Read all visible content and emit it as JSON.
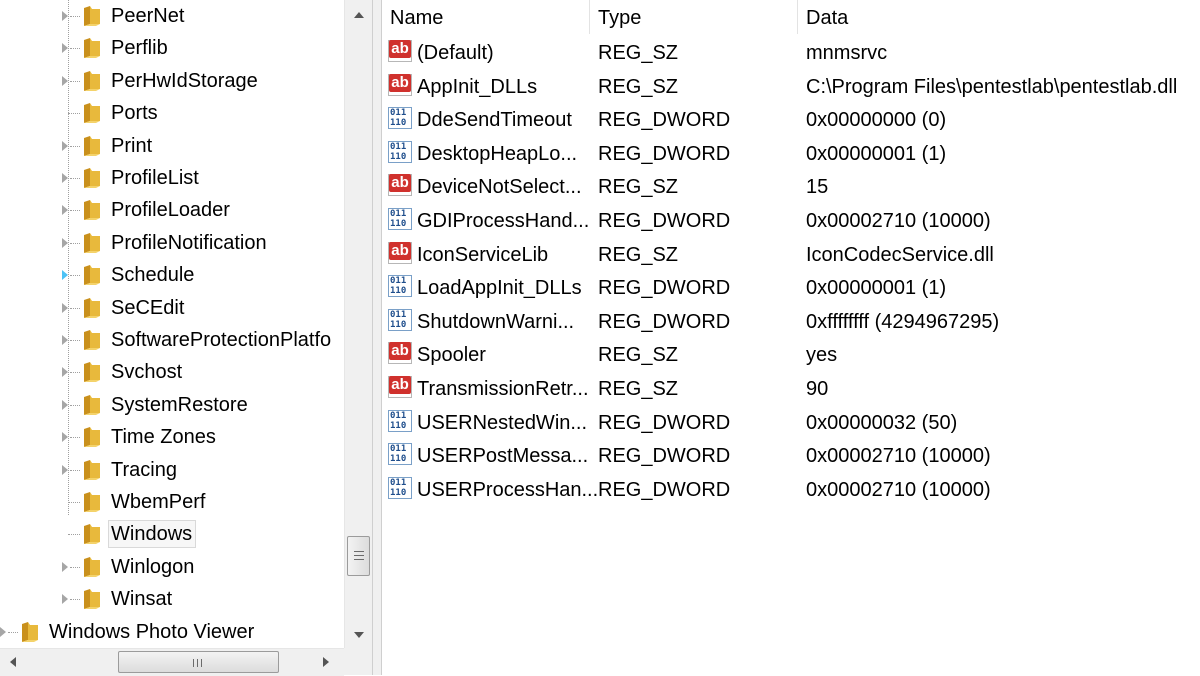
{
  "tree": {
    "items": [
      {
        "label": "PeerNet",
        "expandable": true
      },
      {
        "label": "Perflib",
        "expandable": true
      },
      {
        "label": "PerHwIdStorage",
        "expandable": true
      },
      {
        "label": "Ports",
        "expandable": false
      },
      {
        "label": "Print",
        "expandable": true
      },
      {
        "label": "ProfileList",
        "expandable": true
      },
      {
        "label": "ProfileLoader",
        "expandable": true
      },
      {
        "label": "ProfileNotification",
        "expandable": true
      },
      {
        "label": "Schedule",
        "expandable": true
      },
      {
        "label": "SeCEdit",
        "expandable": true
      },
      {
        "label": "SoftwareProtectionPlatfo",
        "expandable": true
      },
      {
        "label": "Svchost",
        "expandable": true
      },
      {
        "label": "SystemRestore",
        "expandable": true
      },
      {
        "label": "Time Zones",
        "expandable": true
      },
      {
        "label": "Tracing",
        "expandable": true
      },
      {
        "label": "WbemPerf",
        "expandable": false
      },
      {
        "label": "Windows",
        "expandable": false,
        "selected": true
      },
      {
        "label": "Winlogon",
        "expandable": true
      },
      {
        "label": "Winsat",
        "expandable": true
      },
      {
        "label": "Windows Photo Viewer",
        "expandable": true
      }
    ],
    "folder_color": "#e8b93c",
    "hscroll_grip": "|||",
    "vscroll_grip": "≡"
  },
  "list": {
    "headers": {
      "name": "Name",
      "type": "Type",
      "data": "Data"
    },
    "rows": [
      {
        "icon": "string-value-icon",
        "name": "(Default)",
        "type": "REG_SZ",
        "data": "mnmsrvc"
      },
      {
        "icon": "string-value-icon",
        "name": "AppInit_DLLs",
        "type": "REG_SZ",
        "data": "C:\\Program Files\\pentestlab\\pentestlab.dll"
      },
      {
        "icon": "binary-value-icon",
        "name": "DdeSendTimeout",
        "type": "REG_DWORD",
        "data": "0x00000000 (0)"
      },
      {
        "icon": "binary-value-icon",
        "name": "DesktopHeapLo...",
        "type": "REG_DWORD",
        "data": "0x00000001 (1)"
      },
      {
        "icon": "string-value-icon",
        "name": "DeviceNotSelect...",
        "type": "REG_SZ",
        "data": "15"
      },
      {
        "icon": "binary-value-icon",
        "name": "GDIProcessHand...",
        "type": "REG_DWORD",
        "data": "0x00002710 (10000)"
      },
      {
        "icon": "string-value-icon",
        "name": "IconServiceLib",
        "type": "REG_SZ",
        "data": "IconCodecService.dll"
      },
      {
        "icon": "binary-value-icon",
        "name": "LoadAppInit_DLLs",
        "type": "REG_DWORD",
        "data": "0x00000001 (1)"
      },
      {
        "icon": "binary-value-icon",
        "name": "ShutdownWarni...",
        "type": "REG_DWORD",
        "data": "0xffffffff (4294967295)"
      },
      {
        "icon": "string-value-icon",
        "name": "Spooler",
        "type": "REG_SZ",
        "data": "yes"
      },
      {
        "icon": "string-value-icon",
        "name": "TransmissionRetr...",
        "type": "REG_SZ",
        "data": "90"
      },
      {
        "icon": "binary-value-icon",
        "name": "USERNestedWin...",
        "type": "REG_DWORD",
        "data": "0x00000032 (50)"
      },
      {
        "icon": "binary-value-icon",
        "name": "USERPostMessa...",
        "type": "REG_DWORD",
        "data": "0x00002710 (10000)"
      },
      {
        "icon": "binary-value-icon",
        "name": "USERProcessHan...",
        "type": "REG_DWORD",
        "data": "0x00002710 (10000)"
      }
    ],
    "icon_glyphs": {
      "string": "ab",
      "binary": "011\n110"
    }
  }
}
